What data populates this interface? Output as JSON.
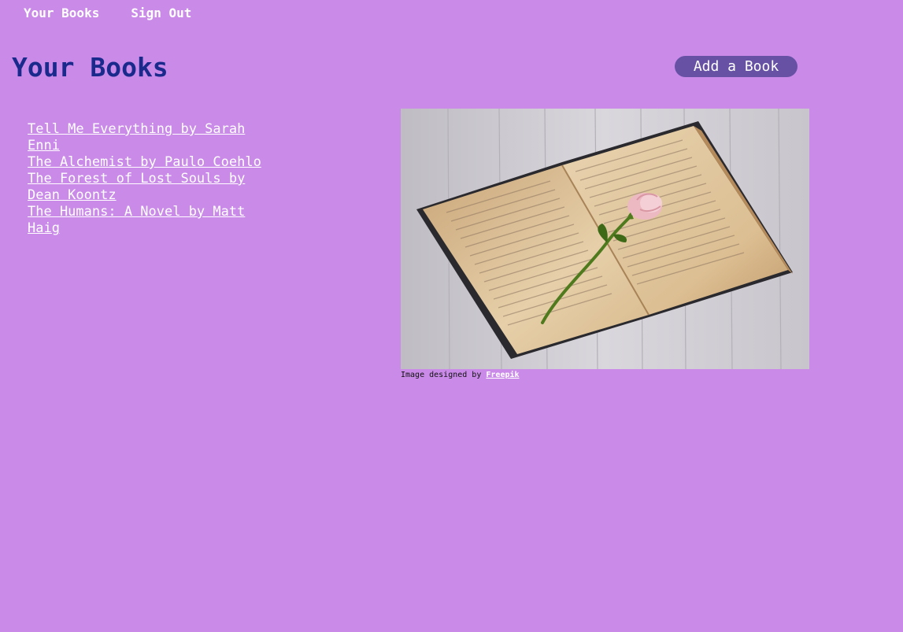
{
  "nav": {
    "items": [
      {
        "label": "Your Books"
      },
      {
        "label": "Sign Out"
      }
    ]
  },
  "page": {
    "title": "Your Books",
    "add_button_label": "Add a Book"
  },
  "books": [
    {
      "label": "Tell Me Everything by Sarah Enni"
    },
    {
      "label": "The Alchemist by Paulo Coehlo"
    },
    {
      "label": "The Forest of Lost Souls by Dean Koontz"
    },
    {
      "label": "The Humans: A Novel by Matt Haig"
    }
  ],
  "image": {
    "credit_prefix": "Image designed by",
    "credit_link": "Freepik"
  },
  "colors": {
    "background": "#c98ae8",
    "title": "#1a2a8c",
    "button": "#6651a5",
    "link": "#ffffff"
  }
}
